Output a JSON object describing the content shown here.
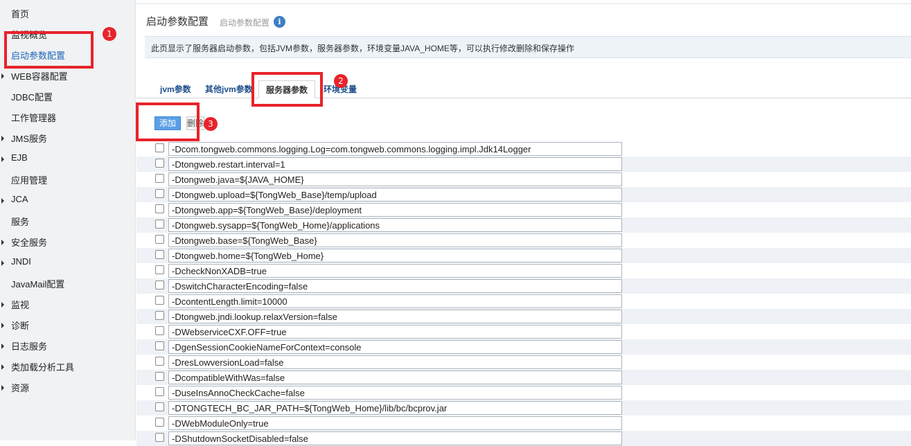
{
  "sidebar": {
    "items": [
      {
        "label": "首页",
        "arrow": false
      },
      {
        "label": "监视概览",
        "arrow": false
      },
      {
        "label": "启动参数配置",
        "arrow": false,
        "active": true
      },
      {
        "label": "WEB容器配置",
        "arrow": true
      },
      {
        "label": "JDBC配置",
        "arrow": false
      },
      {
        "label": "工作管理器",
        "arrow": false
      },
      {
        "label": "JMS服务",
        "arrow": true
      },
      {
        "label": "EJB",
        "arrow": true
      },
      {
        "label": "应用管理",
        "arrow": false
      },
      {
        "label": "JCA",
        "arrow": true
      },
      {
        "label": "服务",
        "arrow": false
      },
      {
        "label": "安全服务",
        "arrow": true
      },
      {
        "label": "JNDI",
        "arrow": true
      },
      {
        "label": "JavaMail配置",
        "arrow": false
      },
      {
        "label": "监视",
        "arrow": true
      },
      {
        "label": "诊断",
        "arrow": true
      },
      {
        "label": "日志服务",
        "arrow": true
      },
      {
        "label": "类加载分析工具",
        "arrow": true
      },
      {
        "label": "资源",
        "arrow": true
      }
    ]
  },
  "header": {
    "title": "启动参数配置",
    "subtitle": "启动参数配置",
    "info_icon": "i"
  },
  "description": "此页显示了服务器启动参数，包括JVM参数，服务器参数，环境变量JAVA_HOME等，可以执行修改删除和保存操作",
  "tabs": [
    {
      "label": "jvm参数"
    },
    {
      "label": "其他jvm参数"
    },
    {
      "label": "服务器参数",
      "active": true
    },
    {
      "label": "环境变量"
    }
  ],
  "toolbar": {
    "add_label": "添加",
    "delete_label": "删除"
  },
  "params": [
    "-Dcom.tongweb.commons.logging.Log=com.tongweb.commons.logging.impl.Jdk14Logger",
    "-Dtongweb.restart.interval=1",
    "-Dtongweb.java=${JAVA_HOME}",
    "-Dtongweb.upload=${TongWeb_Base}/temp/upload",
    "-Dtongweb.app=${TongWeb_Base}/deployment",
    "-Dtongweb.sysapp=${TongWeb_Home}/applications",
    "-Dtongweb.base=${TongWeb_Base}",
    "-Dtongweb.home=${TongWeb_Home}",
    "-DcheckNonXADB=true",
    "-DswitchCharacterEncoding=false",
    "-DcontentLength.limit=10000",
    "-Dtongweb.jndi.lookup.relaxVersion=false",
    "-DWebserviceCXF.OFF=true",
    "-DgenSessionCookieNameForContext=console",
    "-DresLowversionLoad=false",
    "-DcompatibleWithWas=false",
    "-DuseInsAnnoCheckCache=false",
    "-DTONGTECH_BC_JAR_PATH=${TongWeb_Home}/lib/bc/bcprov.jar",
    "-DWebModuleOnly=true",
    "-DShutdownSocketDisabled=false"
  ],
  "annotations": {
    "badge1": "1",
    "badge2": "2",
    "badge3": "3",
    "color": "#e8232b"
  }
}
